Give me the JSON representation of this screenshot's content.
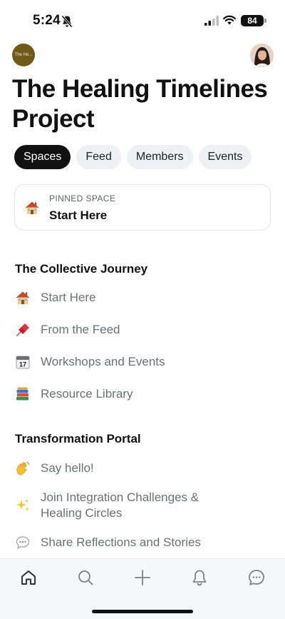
{
  "status": {
    "time": "5:24",
    "battery": "84"
  },
  "community": {
    "logo_text": "The He..."
  },
  "title": "The Healing Timelines Project",
  "tabs": [
    {
      "label": "Spaces",
      "active": true
    },
    {
      "label": "Feed",
      "active": false
    },
    {
      "label": "Members",
      "active": false
    },
    {
      "label": "Events",
      "active": false
    }
  ],
  "pinned": {
    "label": "PINNED SPACE",
    "title": "Start Here",
    "icon": "house-emoji"
  },
  "sections": [
    {
      "heading": "The Collective Journey",
      "items": [
        {
          "icon": "house-emoji",
          "label": "Start Here"
        },
        {
          "icon": "pushpin-emoji",
          "label": "From the Feed"
        },
        {
          "icon": "calendar-emoji",
          "label": "Workshops and Events"
        },
        {
          "icon": "books-emoji",
          "label": "Resource Library"
        }
      ]
    },
    {
      "heading": "Transformation Portal",
      "items": [
        {
          "icon": "waving-hand-emoji",
          "label": "Say hello!"
        },
        {
          "icon": "sparkles-emoji",
          "label": "Join Integration Challenges & Healing Circles"
        },
        {
          "icon": "speech-bubble-emoji",
          "label": "Share Reflections and Stories"
        }
      ]
    }
  ],
  "bottom_nav": [
    "home-icon",
    "search-icon",
    "add-icon",
    "notifications-icon",
    "messages-icon"
  ]
}
